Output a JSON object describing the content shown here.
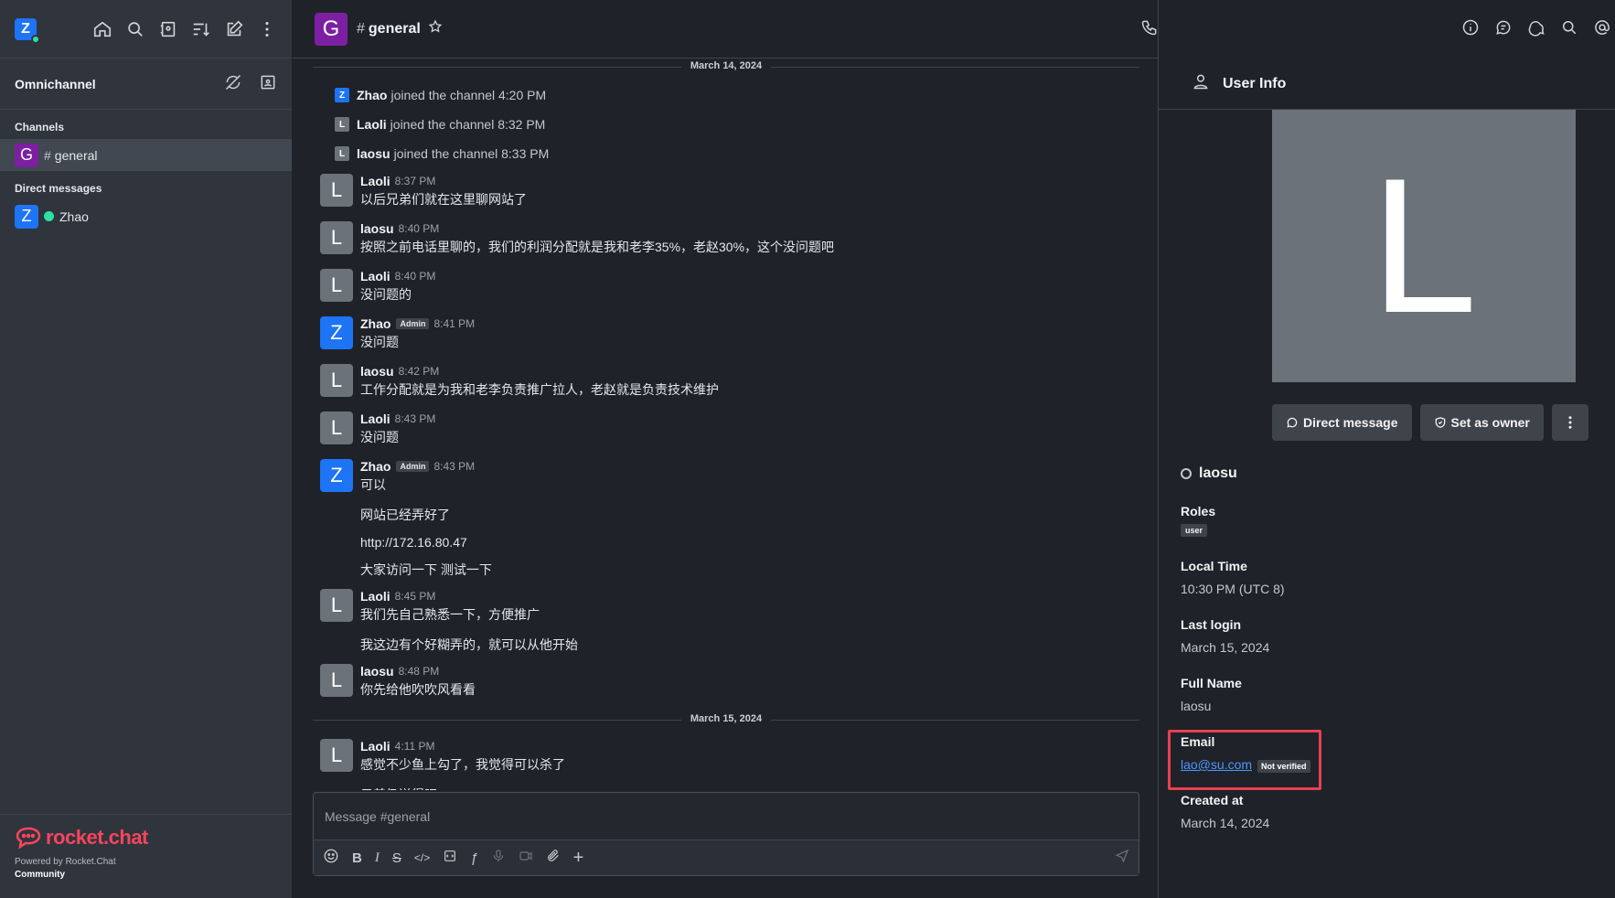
{
  "sidebar": {
    "user_initial": "Z",
    "omnichannel": "Omnichannel",
    "channels_title": "Channels",
    "channel": {
      "initial": "G",
      "hash": "#",
      "name": "general"
    },
    "dm_title": "Direct messages",
    "dm": {
      "initial": "Z",
      "name": "Zhao"
    },
    "brand": "rocket.chat",
    "powered": "Powered by Rocket.Chat",
    "community": "Community"
  },
  "room": {
    "initial": "G",
    "hash": "#",
    "name": "general"
  },
  "messages": {
    "date1": "March 14, 2024",
    "sys1": {
      "initial": "Z",
      "user": "Zhao",
      "text": "joined the channel 4:20 PM"
    },
    "sys2": {
      "initial": "L",
      "user": "Laoli",
      "text": "joined the channel 8:32 PM"
    },
    "sys3": {
      "initial": "L",
      "user": "laosu",
      "text": "joined the channel 8:33 PM"
    },
    "m1": {
      "initial": "L",
      "user": "Laoli",
      "time": "8:37 PM",
      "text": "以后兄弟们就在这里聊网站了"
    },
    "m2": {
      "initial": "L",
      "user": "laosu",
      "time": "8:40 PM",
      "text": "按照之前电话里聊的，我们的利润分配就是我和老李35%，老赵30%，这个没问题吧"
    },
    "m3": {
      "initial": "L",
      "user": "Laoli",
      "time": "8:40 PM",
      "text": "没问题的"
    },
    "m4": {
      "initial": "Z",
      "user": "Zhao",
      "badge": "Admin",
      "time": "8:41 PM",
      "text": "没问题"
    },
    "m5": {
      "initial": "L",
      "user": "laosu",
      "time": "8:42 PM",
      "text": "工作分配就是为我和老李负责推广拉人，老赵就是负责技术维护"
    },
    "m6": {
      "initial": "L",
      "user": "Laoli",
      "time": "8:43 PM",
      "text": "没问题"
    },
    "m7": {
      "initial": "Z",
      "user": "Zhao",
      "badge": "Admin",
      "time": "8:43 PM",
      "text": "可以"
    },
    "m7c1": "网站已经弄好了",
    "m7c2": "http://172.16.80.47",
    "m7c3": "大家访问一下 测试一下",
    "m8": {
      "initial": "L",
      "user": "Laoli",
      "time": "8:45 PM",
      "text": "我们先自己熟悉一下，方便推广"
    },
    "m8c1": "我这边有个好糊弄的，就可以从他开始",
    "m9": {
      "initial": "L",
      "user": "laosu",
      "time": "8:48 PM",
      "text": "你先给他吹吹风看看"
    },
    "date2": "March 15, 2024",
    "m10": {
      "initial": "L",
      "user": "Laoli",
      "time": "4:11 PM",
      "text": "感觉不少鱼上勾了，我觉得可以杀了"
    },
    "m10c1": "只差仍送得吧"
  },
  "composer": {
    "placeholder": "Message #general"
  },
  "panel": {
    "title": "User Info",
    "avatar_initial": "L",
    "direct_message": "Direct message",
    "set_owner": "Set as owner",
    "username": "laosu",
    "roles_label": "Roles",
    "role": "user",
    "local_time_label": "Local Time",
    "local_time": "10:30 PM (UTC 8)",
    "last_login_label": "Last login",
    "last_login": "March 15, 2024",
    "full_name_label": "Full Name",
    "full_name": "laosu",
    "email_label": "Email",
    "email": "lao@su.com",
    "not_verified": "Not verified",
    "created_label": "Created at",
    "created": "March 14, 2024"
  },
  "colors": {
    "accent": "#1d74f5",
    "channel": "#7c1fa2",
    "user_l": "#6c727a",
    "highlight": "#e6414f",
    "online": "#2de0a5"
  }
}
